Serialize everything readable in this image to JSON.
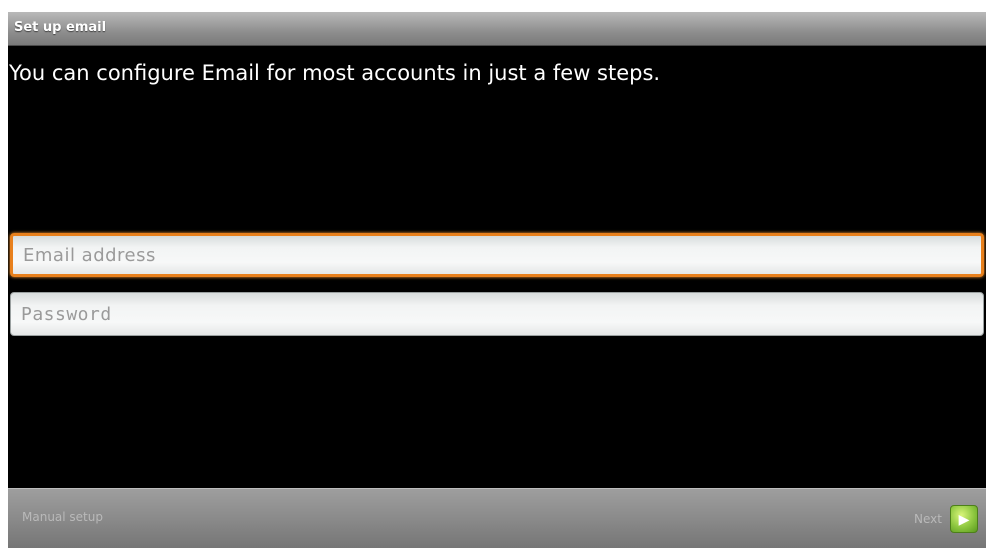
{
  "titlebar": {
    "title": "Set up email"
  },
  "main": {
    "instructions": "You can configure Email for most accounts in just a few steps.",
    "email_field": {
      "placeholder": "Email address",
      "value": ""
    },
    "password_field": {
      "placeholder": "Password",
      "value": ""
    }
  },
  "bottombar": {
    "manual_setup_label": "Manual setup",
    "next_label": "Next"
  },
  "colors": {
    "focus_border": "#e8801c",
    "next_icon": "#8cc63f"
  },
  "icons": {
    "next": "next-arrow-icon"
  }
}
